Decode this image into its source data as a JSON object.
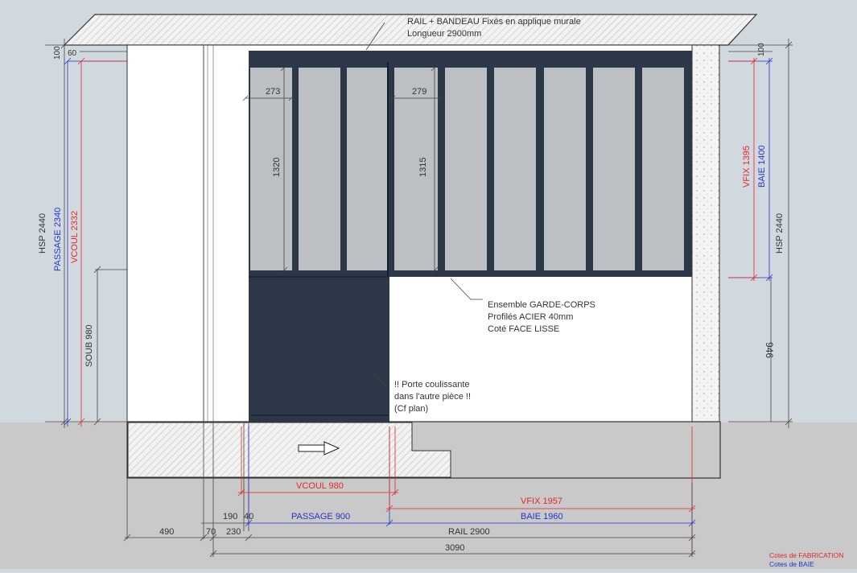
{
  "colors": {
    "wall_bg": "#d1d9df",
    "floor": "#c9c9c9",
    "steel": "#2c3848",
    "glass": "#bcc0c4",
    "fabrication_red": "#e3272b",
    "baie_blue": "#2832c8"
  },
  "annotations": {
    "rail_line1": "RAIL + BANDEAU Fixés en applique murale",
    "rail_line2": "Longueur 2900mm",
    "garde_line1": "Ensemble GARDE-CORPS",
    "garde_line2": "Profilés ACIER 40mm",
    "garde_line3": "Coté FACE LISSE",
    "porte_line1": "!! Porte coulissante",
    "porte_line2": "dans l'autre pièce !!",
    "porte_line3": "(Cf plan)"
  },
  "dims": {
    "hsp_left": "HSP 2440",
    "passage_left": "PASSAGE 2340",
    "vcoul_left": "VCOUL 2332",
    "soub": "SOUB 980",
    "top_100_left": "100",
    "top_60": "60",
    "w273": "273",
    "w279": "279",
    "h1320": "1320",
    "h1315": "1315",
    "vfix_right": "VFIX 1395",
    "baie_right": "BAIE 1400",
    "hsp_right": "HSP 2440",
    "top_100_right": "100",
    "r946": "946",
    "vcoul_bottom": "VCOUL 980",
    "vfix_bottom": "VFIX 1957",
    "b190": "190",
    "b40": "40",
    "passage_bottom": "PASSAGE 900",
    "baie_bottom": "BAIE 1960",
    "b490": "490",
    "b70": "70",
    "b230": "230",
    "rail_bottom": "RAIL 2900",
    "total": "3090"
  },
  "legend": {
    "fabrication": "Cotes de FABRICATION",
    "baie": "Cotes de BAIE"
  },
  "icons": {
    "arrow": "arrow-right-icon"
  }
}
